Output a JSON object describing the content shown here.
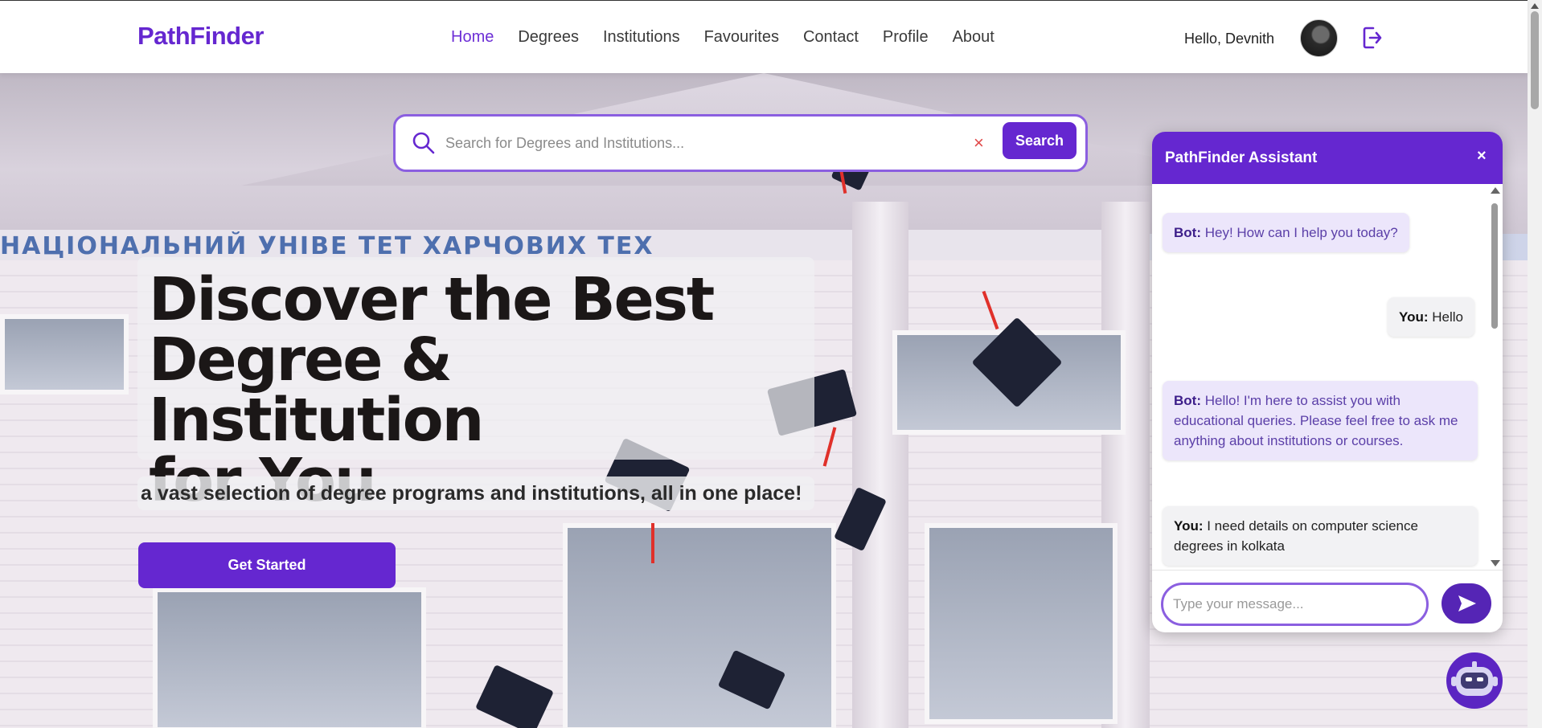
{
  "brand": "PathFinder",
  "nav": {
    "links": [
      "Home",
      "Degrees",
      "Institutions",
      "Favourites",
      "Contact",
      "Profile",
      "About"
    ],
    "active": "Home",
    "greeting": "Hello, Devnith"
  },
  "search": {
    "placeholder": "Search for Degrees and Institutions...",
    "value": "",
    "button_label": "Search",
    "clear_glyph": "×"
  },
  "hero": {
    "headline_lines": [
      "Discover the Best",
      "Degree & Institution",
      "for You"
    ],
    "subline": "a vast selection of degree programs and institutions, all in one place!",
    "cta_label": "Get Started",
    "background_sign_text": "НАЦІОНАЛЬНИЙ УНІВЕ  ТЕТ ХАРЧОВИХ ТЕХ"
  },
  "chat": {
    "title": "PathFinder Assistant",
    "close_glyph": "×",
    "messages": [
      {
        "sender": "bot",
        "prefix": "Bot:",
        "text": " Hey! How can I help you today?"
      },
      {
        "sender": "user",
        "prefix": "You:",
        "text": " Hello"
      },
      {
        "sender": "bot",
        "prefix": "Bot:",
        "text": " Hello! I'm here to assist you with educational queries. Please feel free to ask me anything about institutions or courses."
      },
      {
        "sender": "user",
        "prefix": "You:",
        "text": " I need details on computer science degrees in kolkata"
      }
    ],
    "input_placeholder": "Type your message...",
    "input_value": ""
  },
  "colors": {
    "brand_purple": "#6527d0",
    "accent_border": "#8b5fe0",
    "bot_bubble": "#ece6fb",
    "user_bubble": "#f2f2f4"
  },
  "icons": {
    "search": "search-icon",
    "clear": "close-icon",
    "logout": "logout-icon",
    "send": "send-icon",
    "chatbot": "robot-icon",
    "avatar": "avatar"
  }
}
